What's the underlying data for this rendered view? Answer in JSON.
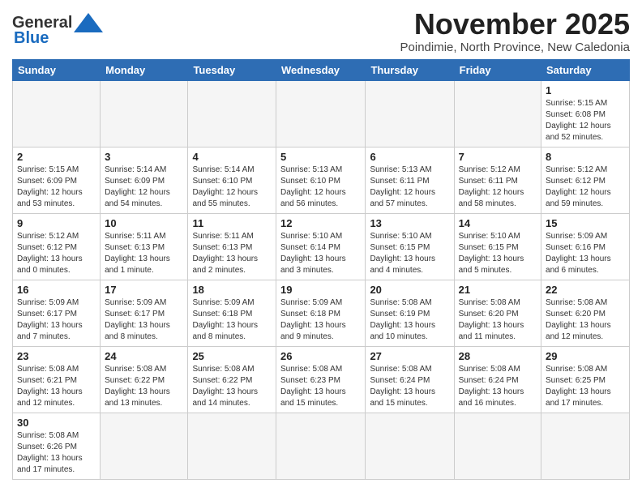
{
  "header": {
    "logo_general": "General",
    "logo_blue": "Blue",
    "month_title": "November 2025",
    "location": "Poindimie, North Province, New Caledonia"
  },
  "weekdays": [
    "Sunday",
    "Monday",
    "Tuesday",
    "Wednesday",
    "Thursday",
    "Friday",
    "Saturday"
  ],
  "weeks": [
    [
      {
        "day": "",
        "info": ""
      },
      {
        "day": "",
        "info": ""
      },
      {
        "day": "",
        "info": ""
      },
      {
        "day": "",
        "info": ""
      },
      {
        "day": "",
        "info": ""
      },
      {
        "day": "",
        "info": ""
      },
      {
        "day": "1",
        "info": "Sunrise: 5:15 AM\nSunset: 6:08 PM\nDaylight: 12 hours\nand 52 minutes."
      }
    ],
    [
      {
        "day": "2",
        "info": "Sunrise: 5:15 AM\nSunset: 6:09 PM\nDaylight: 12 hours\nand 53 minutes."
      },
      {
        "day": "3",
        "info": "Sunrise: 5:14 AM\nSunset: 6:09 PM\nDaylight: 12 hours\nand 54 minutes."
      },
      {
        "day": "4",
        "info": "Sunrise: 5:14 AM\nSunset: 6:10 PM\nDaylight: 12 hours\nand 55 minutes."
      },
      {
        "day": "5",
        "info": "Sunrise: 5:13 AM\nSunset: 6:10 PM\nDaylight: 12 hours\nand 56 minutes."
      },
      {
        "day": "6",
        "info": "Sunrise: 5:13 AM\nSunset: 6:11 PM\nDaylight: 12 hours\nand 57 minutes."
      },
      {
        "day": "7",
        "info": "Sunrise: 5:12 AM\nSunset: 6:11 PM\nDaylight: 12 hours\nand 58 minutes."
      },
      {
        "day": "8",
        "info": "Sunrise: 5:12 AM\nSunset: 6:12 PM\nDaylight: 12 hours\nand 59 minutes."
      }
    ],
    [
      {
        "day": "9",
        "info": "Sunrise: 5:12 AM\nSunset: 6:12 PM\nDaylight: 13 hours\nand 0 minutes."
      },
      {
        "day": "10",
        "info": "Sunrise: 5:11 AM\nSunset: 6:13 PM\nDaylight: 13 hours\nand 1 minute."
      },
      {
        "day": "11",
        "info": "Sunrise: 5:11 AM\nSunset: 6:13 PM\nDaylight: 13 hours\nand 2 minutes."
      },
      {
        "day": "12",
        "info": "Sunrise: 5:10 AM\nSunset: 6:14 PM\nDaylight: 13 hours\nand 3 minutes."
      },
      {
        "day": "13",
        "info": "Sunrise: 5:10 AM\nSunset: 6:15 PM\nDaylight: 13 hours\nand 4 minutes."
      },
      {
        "day": "14",
        "info": "Sunrise: 5:10 AM\nSunset: 6:15 PM\nDaylight: 13 hours\nand 5 minutes."
      },
      {
        "day": "15",
        "info": "Sunrise: 5:09 AM\nSunset: 6:16 PM\nDaylight: 13 hours\nand 6 minutes."
      }
    ],
    [
      {
        "day": "16",
        "info": "Sunrise: 5:09 AM\nSunset: 6:17 PM\nDaylight: 13 hours\nand 7 minutes."
      },
      {
        "day": "17",
        "info": "Sunrise: 5:09 AM\nSunset: 6:17 PM\nDaylight: 13 hours\nand 8 minutes."
      },
      {
        "day": "18",
        "info": "Sunrise: 5:09 AM\nSunset: 6:18 PM\nDaylight: 13 hours\nand 8 minutes."
      },
      {
        "day": "19",
        "info": "Sunrise: 5:09 AM\nSunset: 6:18 PM\nDaylight: 13 hours\nand 9 minutes."
      },
      {
        "day": "20",
        "info": "Sunrise: 5:08 AM\nSunset: 6:19 PM\nDaylight: 13 hours\nand 10 minutes."
      },
      {
        "day": "21",
        "info": "Sunrise: 5:08 AM\nSunset: 6:20 PM\nDaylight: 13 hours\nand 11 minutes."
      },
      {
        "day": "22",
        "info": "Sunrise: 5:08 AM\nSunset: 6:20 PM\nDaylight: 13 hours\nand 12 minutes."
      }
    ],
    [
      {
        "day": "23",
        "info": "Sunrise: 5:08 AM\nSunset: 6:21 PM\nDaylight: 13 hours\nand 12 minutes."
      },
      {
        "day": "24",
        "info": "Sunrise: 5:08 AM\nSunset: 6:22 PM\nDaylight: 13 hours\nand 13 minutes."
      },
      {
        "day": "25",
        "info": "Sunrise: 5:08 AM\nSunset: 6:22 PM\nDaylight: 13 hours\nand 14 minutes."
      },
      {
        "day": "26",
        "info": "Sunrise: 5:08 AM\nSunset: 6:23 PM\nDaylight: 13 hours\nand 15 minutes."
      },
      {
        "day": "27",
        "info": "Sunrise: 5:08 AM\nSunset: 6:24 PM\nDaylight: 13 hours\nand 15 minutes."
      },
      {
        "day": "28",
        "info": "Sunrise: 5:08 AM\nSunset: 6:24 PM\nDaylight: 13 hours\nand 16 minutes."
      },
      {
        "day": "29",
        "info": "Sunrise: 5:08 AM\nSunset: 6:25 PM\nDaylight: 13 hours\nand 17 minutes."
      }
    ],
    [
      {
        "day": "30",
        "info": "Sunrise: 5:08 AM\nSunset: 6:26 PM\nDaylight: 13 hours\nand 17 minutes."
      },
      {
        "day": "",
        "info": ""
      },
      {
        "day": "",
        "info": ""
      },
      {
        "day": "",
        "info": ""
      },
      {
        "day": "",
        "info": ""
      },
      {
        "day": "",
        "info": ""
      },
      {
        "day": "",
        "info": ""
      }
    ]
  ]
}
